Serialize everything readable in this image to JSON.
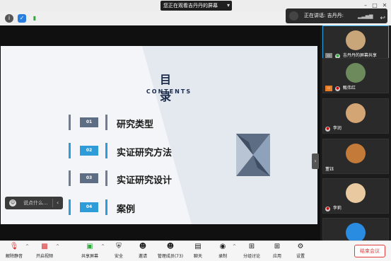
{
  "titlebar": {
    "share_status": "您正在观看吉丹丹的屏幕",
    "pill_arrow": "▾",
    "min_icon": "–",
    "max_icon": "□",
    "close_icon": "✕"
  },
  "iconrow": {
    "info_icon": "i",
    "shield_icon": "✓",
    "signal_icon": "▮"
  },
  "speaking": {
    "label": "正在讲话: 吉丹丹:"
  },
  "slide": {
    "title": "目 录",
    "subtitle": "CONTENTS",
    "items": [
      {
        "num": "01",
        "label": "研究类型"
      },
      {
        "num": "02",
        "label": "实证研究方法"
      },
      {
        "num": "03",
        "label": "实证研究设计"
      },
      {
        "num": "04",
        "label": "案例"
      }
    ]
  },
  "chat": {
    "placeholder": "说点什么...",
    "collapse": "‹"
  },
  "side_handle": "›",
  "participants": [
    {
      "name": "吉丹丹的屏幕共享",
      "avatar_color": "#c9a57a"
    },
    {
      "name": "甄伟红",
      "avatar_color": "#6c8a5c"
    },
    {
      "name": "李润",
      "avatar_color": "#d4a574"
    },
    {
      "name": "董钰",
      "avatar_color": "#c47b3a"
    },
    {
      "name": "李莉",
      "avatar_color": "#e8c9a0"
    },
    {
      "name": "",
      "avatar_color": "#2a8ce0"
    }
  ],
  "toolbar": {
    "mute": "解除静音",
    "video": "开启视频",
    "share": "共享屏幕",
    "security": "安全",
    "invite": "邀请",
    "members": "管理成员(73)",
    "chat": "聊天",
    "record": "录制",
    "breakout": "分组讨论",
    "apps": "应用",
    "settings": "设置",
    "end": "结束会议"
  },
  "colors": {
    "accent": "#2e9cd8",
    "slate": "#5d6d83",
    "end_red": "#e23b3b"
  }
}
